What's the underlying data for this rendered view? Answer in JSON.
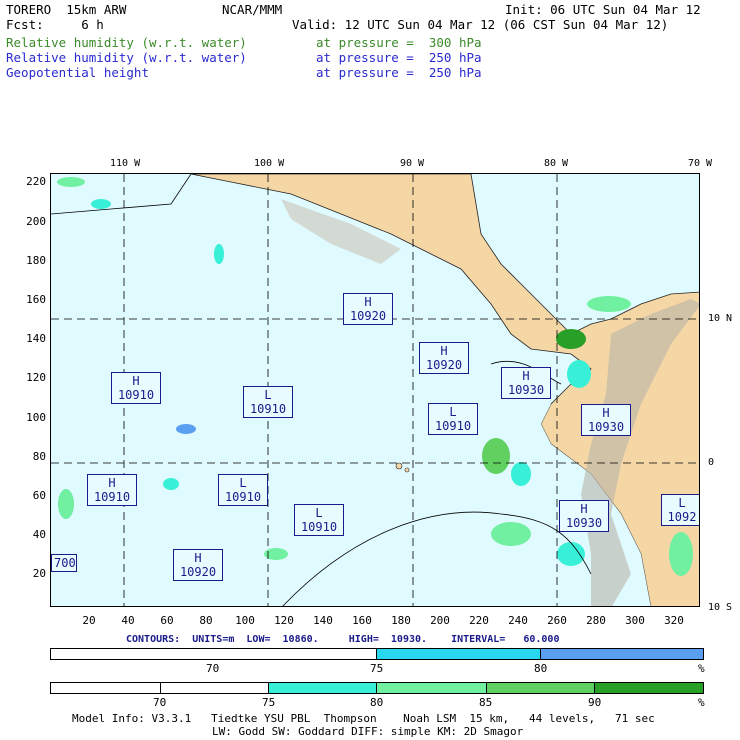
{
  "header": {
    "model": "TORERO  15km ARW",
    "org": "NCAR/MMM",
    "init": "Init: 06 UTC Sun 04 Mar 12",
    "fcst": "Fcst:     6 h",
    "valid": "Valid: 12 UTC Sun 04 Mar 12 (06 CST Sun 04 Mar 12)",
    "fields": [
      {
        "name": "Relative humidity (w.r.t. water)",
        "level": "at pressure =  300 hPa",
        "color": "#3b8a2a"
      },
      {
        "name": "Relative humidity (w.r.t. water)",
        "level": "at pressure =  250 hPa",
        "color": "#2a2ad0"
      },
      {
        "name": "Geopotential height",
        "level": "at pressure =  250 hPa",
        "color": "#000000"
      }
    ]
  },
  "map": {
    "lon_labels": [
      "110 W",
      "100 W",
      "90 W",
      "80 W",
      "70 W"
    ],
    "lat_labels": [
      "10 N",
      "0",
      "10 S"
    ],
    "y_ticks": [
      "220",
      "200",
      "180",
      "160",
      "140",
      "120",
      "100",
      "80",
      "60",
      "40",
      "20"
    ],
    "x_ticks": [
      "20",
      "40",
      "60",
      "80",
      "100",
      "120",
      "140",
      "160",
      "180",
      "200",
      "220",
      "240",
      "260",
      "280",
      "300",
      "320"
    ],
    "height_labels": [
      {
        "type": "H",
        "value": "10920"
      },
      {
        "type": "H",
        "value": "10920"
      },
      {
        "type": "H",
        "value": "10910"
      },
      {
        "type": "L",
        "value": "10910"
      },
      {
        "type": "H",
        "value": "10930"
      },
      {
        "type": "L",
        "value": "10910"
      },
      {
        "type": "H",
        "value": "10930"
      },
      {
        "type": "H",
        "value": "10910"
      },
      {
        "type": "L",
        "value": "10910"
      },
      {
        "type": "L",
        "value": "10910"
      },
      {
        "type": "H",
        "value": "10930"
      },
      {
        "type": "L",
        "value": "1092"
      },
      {
        "type": "H",
        "value": "10920"
      },
      {
        "type": "",
        "value": "700"
      }
    ]
  },
  "contours": "CONTOURS:  UNITS=m  LOW=  10860.     HIGH=  10930.    INTERVAL=   60.000",
  "colorbar_250": {
    "labels": [
      "70",
      "75",
      "80",
      "%"
    ],
    "colors": [
      "#ffffff",
      "#28d8f0",
      "#5aa0f0"
    ]
  },
  "colorbar_300": {
    "labels": [
      "70",
      "75",
      "80",
      "85",
      "90",
      "%"
    ],
    "colors": [
      "#ffffff",
      "#ffffff",
      "#38f0d8",
      "#70f0a0",
      "#60d060",
      "#28a028"
    ]
  },
  "footer": {
    "line1": "Model Info: V3.3.1   Tiedtke YSU PBL  Thompson    Noah LSM  15 km,   44 levels,   71 sec",
    "line2": "LW: Godd SW: Goddard DIFF: simple KM: 2D Smagor"
  },
  "colors": {
    "ocean": "#e0fbff",
    "land": "#f5d7a6",
    "grid": "#000000"
  }
}
